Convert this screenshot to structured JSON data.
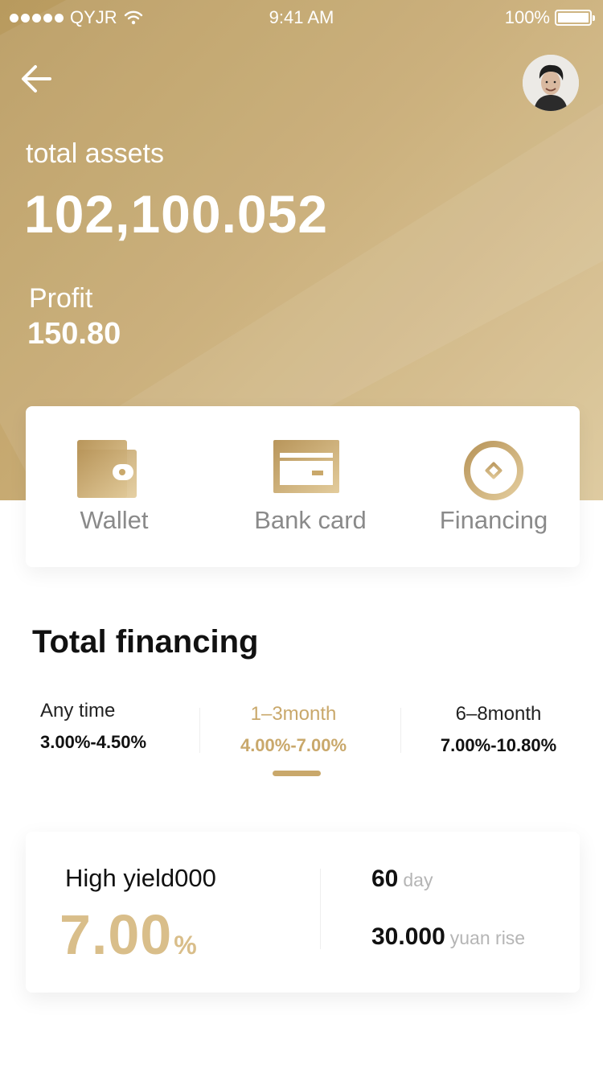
{
  "status_bar": {
    "carrier": "QYJR",
    "time": "9:41 AM",
    "battery": "100%"
  },
  "header": {
    "total_assets_label": "total assets",
    "total_assets_value": "102,100.052",
    "profit_label": "Profit",
    "profit_value": "150.80"
  },
  "quick_actions": [
    {
      "label": "Wallet",
      "icon": "wallet-icon"
    },
    {
      "label": "Bank card",
      "icon": "bank-card-icon"
    },
    {
      "label": "Financing",
      "icon": "financing-icon"
    }
  ],
  "financing": {
    "title": "Total financing",
    "tabs": [
      {
        "name": "Any time",
        "rate": "3.00%-4.50%",
        "active": false
      },
      {
        "name": "1–3month",
        "rate": "4.00%-7.00%",
        "active": true
      },
      {
        "name": "6–8month",
        "rate": "7.00%-10.80%",
        "active": false
      }
    ]
  },
  "product": {
    "name": "High yield000",
    "rate": "7.00",
    "rate_unit": "%",
    "term_value": "60",
    "term_unit": "day",
    "min_value": "30.000",
    "min_unit": "yuan rise"
  },
  "colors": {
    "gold": "#c9a86b",
    "gold_light": "#d9be8a",
    "hero_start": "#b89a5e",
    "hero_end": "#dcc79a"
  }
}
